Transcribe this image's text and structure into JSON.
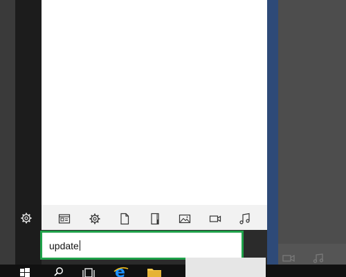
{
  "search": {
    "value": "update",
    "placeholder": ""
  },
  "filters": [
    {
      "icon": "apps-icon"
    },
    {
      "icon": "settings-icon"
    },
    {
      "icon": "documents-icon"
    },
    {
      "icon": "folders-icon"
    },
    {
      "icon": "photos-icon"
    },
    {
      "icon": "videos-icon"
    },
    {
      "icon": "music-icon"
    }
  ],
  "taskbar": {
    "items": [
      "start-icon",
      "search-icon",
      "task-view-icon",
      "edge-icon",
      "file-explorer-icon"
    ]
  },
  "colors": {
    "search_highlight": "#1fa14a",
    "results_bg": "#ffffff",
    "taskbar_bg": "#111111",
    "accent_blue": "#2e4a78"
  }
}
